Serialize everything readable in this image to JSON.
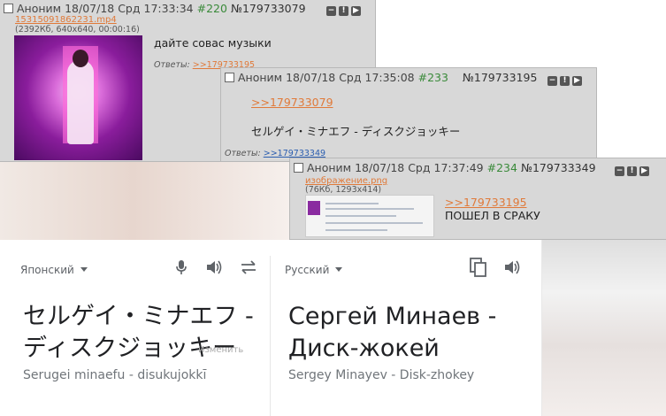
{
  "post1": {
    "author": "Аноним",
    "date": "18/07/18 Срд 17:33:34",
    "num": "#220",
    "id": "№179733079",
    "file_name": "15315091862231.mp4",
    "file_meta": "(2392Кб, 640x640, 00:00:16)",
    "text": "дайте совас музыки",
    "replies_label": "Ответы:",
    "replies_link": ">>179733195"
  },
  "post2": {
    "author": "Аноним",
    "date": "18/07/18 Срд 17:35:08",
    "num": "#233",
    "id": "№179733195",
    "reply_link": ">>179733079",
    "text": "セルゲイ・ミナエフ - ディスクジョッキー",
    "replies_label": "Ответы:",
    "replies_link": ">>179733349"
  },
  "post3": {
    "author": "Аноним",
    "date": "18/07/18 Срд 17:37:49",
    "num": "#234",
    "id": "№179733349",
    "file_name": "изображение.png",
    "file_meta": "(76Кб, 1293x414)",
    "reply_link": ">>179733195",
    "text": "ПОШЕЛ В СРАКУ"
  },
  "post_buttons": [
    "−",
    "!",
    "▶"
  ],
  "translate": {
    "source_lang": "Японский",
    "target_lang": "Русский",
    "source_text": "セルゲイ・ミナエフ - ディスクジョッキー",
    "source_translit": "Serugei minaefu - disukujokkī",
    "edit_label": "Изменить",
    "target_text": "Сергей Минаев - Диск-жокей",
    "target_translit": "Sergey Minayev - Disk-zhokey",
    "icons": {
      "mic": "microphone-icon",
      "speaker": "speaker-icon",
      "swap": "swap-icon",
      "copy": "copy-icon"
    }
  }
}
